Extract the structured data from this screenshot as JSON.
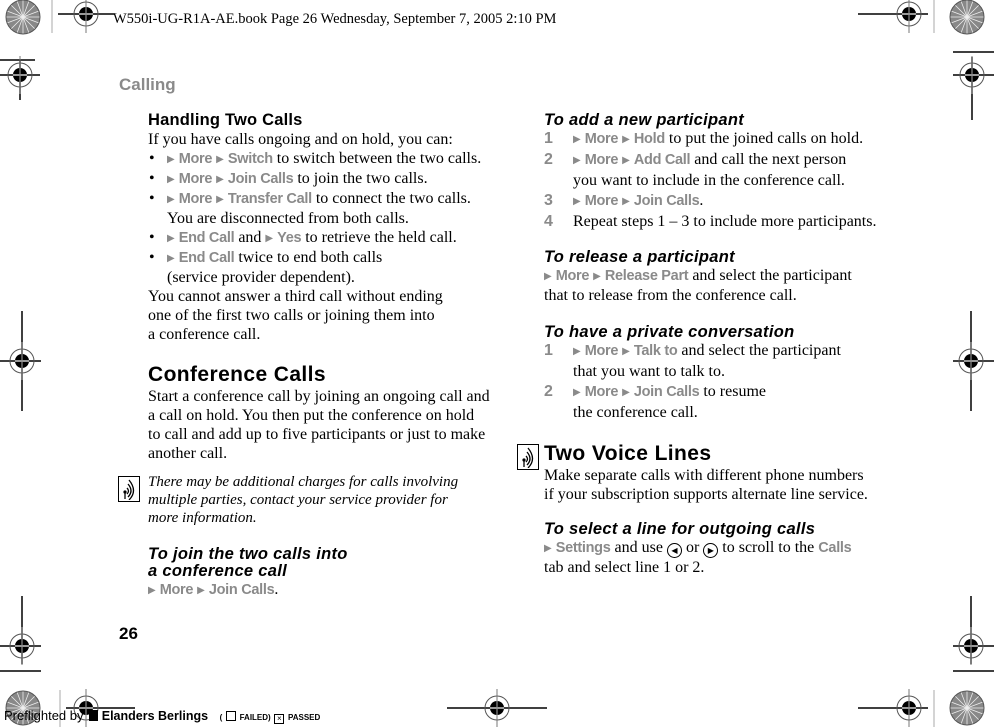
{
  "slug_line": "W550i-UG-R1A-AE.book  Page 26  Wednesday, September 7, 2005  2:10 PM",
  "chapter_title": "Calling",
  "page_number": "26",
  "colors": {
    "menu_gray": "#8a8a8a",
    "text": "#000000"
  },
  "left_column": {
    "handling": {
      "title": "Handling Two Calls",
      "intro": "If you have calls ongoing and on hold, you can:",
      "bullets": [
        {
          "menu": [
            "More",
            "Switch"
          ],
          "text": " to switch between the two calls."
        },
        {
          "menu": [
            "More",
            "Join Calls"
          ],
          "text": " to join the two calls."
        },
        {
          "menu": [
            "More",
            "Transfer Call"
          ],
          "text": " to connect the two calls.",
          "cont": "You are disconnected from both calls."
        },
        {
          "menu": [
            "End Call"
          ],
          "mid": " and ",
          "menu2": [
            "Yes"
          ],
          "text": " to retrieve the held call."
        },
        {
          "menu": [
            "End Call"
          ],
          "text": " twice to end both calls",
          "cont": "(service provider dependent)."
        }
      ],
      "outro": [
        "You cannot answer a third call without ending",
        "one of the first two calls or joining them into",
        "a conference call."
      ]
    },
    "conference": {
      "title": "Conference Calls",
      "body": [
        "Start a conference call by joining an ongoing call and",
        "a call on hold. You then put the conference on hold",
        "to call and add up to five participants or just to make",
        "another call."
      ],
      "note": [
        "There may be additional charges for calls involving",
        "multiple parties, contact your service provider for",
        "more information."
      ],
      "note_icon": "network-note-icon"
    },
    "join": {
      "title": [
        "To join the two calls into",
        "a conference call"
      ],
      "menu": [
        "More",
        "Join Calls"
      ],
      "suffix": "."
    }
  },
  "right_column": {
    "add": {
      "title": "To add a new participant",
      "steps": [
        {
          "num": "1",
          "menu": [
            "More",
            "Hold"
          ],
          "text": " to put the joined calls on hold."
        },
        {
          "num": "2",
          "menu": [
            "More",
            "Add Call"
          ],
          "text": " and call the next person",
          "cont": "you want to include in the conference call."
        },
        {
          "num": "3",
          "menu": [
            "More",
            "Join Calls"
          ],
          "text": "."
        },
        {
          "num": "4",
          "text": "Repeat steps 1 – 3 to include more participants."
        }
      ]
    },
    "release": {
      "title": "To release a participant",
      "menu": [
        "More",
        "Release Part"
      ],
      "text": " and select the participant",
      "cont": "that to release from the conference call."
    },
    "private": {
      "title": "To have a private conversation",
      "steps": [
        {
          "num": "1",
          "menu": [
            "More",
            "Talk to"
          ],
          "text": " and select the participant",
          "cont": "that you want to talk to."
        },
        {
          "num": "2",
          "menu": [
            "More",
            "Join Calls"
          ],
          "text": " to resume",
          "cont": "the conference call."
        }
      ]
    },
    "voice_lines": {
      "title": "Two Voice Lines",
      "body": [
        "Make separate calls with different phone numbers",
        "if your subscription supports alternate line service."
      ],
      "note_icon": "network-note-icon"
    },
    "select_line": {
      "title": "To select a line for outgoing calls",
      "menu": [
        "Settings"
      ],
      "text1": " and use ",
      "or": " or ",
      "text2": " to scroll to the ",
      "menu_end": "Calls",
      "cont": "tab and select line 1 or 2.",
      "icons": [
        "navigate-left-icon",
        "navigate-right-icon"
      ]
    }
  },
  "footer": {
    "preflighted_by": "Preflighted by",
    "brand": "Elanders Berlings",
    "failed_label": "FAILED",
    "passed_label": "PASSED",
    "passed_checked": true,
    "failed_checked": false
  }
}
